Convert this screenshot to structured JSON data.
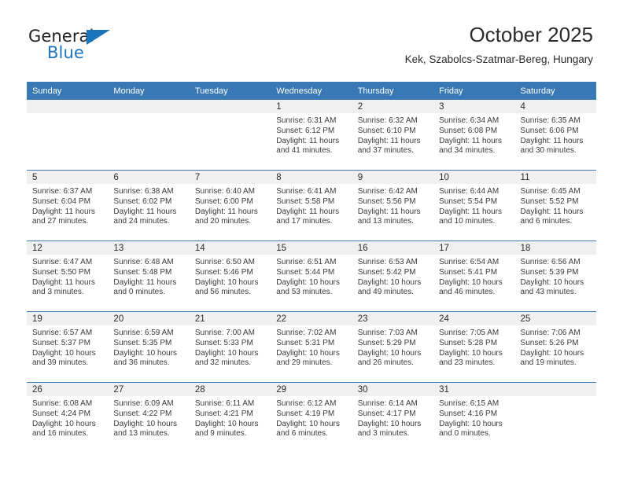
{
  "branding": {
    "logo_text_primary": "General",
    "logo_text_secondary": "Blue",
    "accent_color": "#1b75bb",
    "header_bar_color": "#3878b4"
  },
  "header": {
    "title": "October 2025",
    "subtitle": "Kek, Szabolcs-Szatmar-Bereg, Hungary"
  },
  "weekday_headers": [
    "Sunday",
    "Monday",
    "Tuesday",
    "Wednesday",
    "Thursday",
    "Friday",
    "Saturday"
  ],
  "calendar": {
    "month": "October",
    "year": "2025",
    "labels": {
      "sunrise": "Sunrise:",
      "sunset": "Sunset:",
      "daylight": "Daylight:"
    },
    "weeks": [
      [
        {
          "day": "",
          "empty": true
        },
        {
          "day": "",
          "empty": true
        },
        {
          "day": "",
          "empty": true
        },
        {
          "day": "1",
          "sunrise": "Sunrise: 6:31 AM",
          "sunset": "Sunset: 6:12 PM",
          "daylight_line1": "Daylight: 11 hours",
          "daylight_line2": "and 41 minutes."
        },
        {
          "day": "2",
          "sunrise": "Sunrise: 6:32 AM",
          "sunset": "Sunset: 6:10 PM",
          "daylight_line1": "Daylight: 11 hours",
          "daylight_line2": "and 37 minutes."
        },
        {
          "day": "3",
          "sunrise": "Sunrise: 6:34 AM",
          "sunset": "Sunset: 6:08 PM",
          "daylight_line1": "Daylight: 11 hours",
          "daylight_line2": "and 34 minutes."
        },
        {
          "day": "4",
          "sunrise": "Sunrise: 6:35 AM",
          "sunset": "Sunset: 6:06 PM",
          "daylight_line1": "Daylight: 11 hours",
          "daylight_line2": "and 30 minutes."
        }
      ],
      [
        {
          "day": "5",
          "sunrise": "Sunrise: 6:37 AM",
          "sunset": "Sunset: 6:04 PM",
          "daylight_line1": "Daylight: 11 hours",
          "daylight_line2": "and 27 minutes."
        },
        {
          "day": "6",
          "sunrise": "Sunrise: 6:38 AM",
          "sunset": "Sunset: 6:02 PM",
          "daylight_line1": "Daylight: 11 hours",
          "daylight_line2": "and 24 minutes."
        },
        {
          "day": "7",
          "sunrise": "Sunrise: 6:40 AM",
          "sunset": "Sunset: 6:00 PM",
          "daylight_line1": "Daylight: 11 hours",
          "daylight_line2": "and 20 minutes."
        },
        {
          "day": "8",
          "sunrise": "Sunrise: 6:41 AM",
          "sunset": "Sunset: 5:58 PM",
          "daylight_line1": "Daylight: 11 hours",
          "daylight_line2": "and 17 minutes."
        },
        {
          "day": "9",
          "sunrise": "Sunrise: 6:42 AM",
          "sunset": "Sunset: 5:56 PM",
          "daylight_line1": "Daylight: 11 hours",
          "daylight_line2": "and 13 minutes."
        },
        {
          "day": "10",
          "sunrise": "Sunrise: 6:44 AM",
          "sunset": "Sunset: 5:54 PM",
          "daylight_line1": "Daylight: 11 hours",
          "daylight_line2": "and 10 minutes."
        },
        {
          "day": "11",
          "sunrise": "Sunrise: 6:45 AM",
          "sunset": "Sunset: 5:52 PM",
          "daylight_line1": "Daylight: 11 hours",
          "daylight_line2": "and 6 minutes."
        }
      ],
      [
        {
          "day": "12",
          "sunrise": "Sunrise: 6:47 AM",
          "sunset": "Sunset: 5:50 PM",
          "daylight_line1": "Daylight: 11 hours",
          "daylight_line2": "and 3 minutes."
        },
        {
          "day": "13",
          "sunrise": "Sunrise: 6:48 AM",
          "sunset": "Sunset: 5:48 PM",
          "daylight_line1": "Daylight: 11 hours",
          "daylight_line2": "and 0 minutes."
        },
        {
          "day": "14",
          "sunrise": "Sunrise: 6:50 AM",
          "sunset": "Sunset: 5:46 PM",
          "daylight_line1": "Daylight: 10 hours",
          "daylight_line2": "and 56 minutes."
        },
        {
          "day": "15",
          "sunrise": "Sunrise: 6:51 AM",
          "sunset": "Sunset: 5:44 PM",
          "daylight_line1": "Daylight: 10 hours",
          "daylight_line2": "and 53 minutes."
        },
        {
          "day": "16",
          "sunrise": "Sunrise: 6:53 AM",
          "sunset": "Sunset: 5:42 PM",
          "daylight_line1": "Daylight: 10 hours",
          "daylight_line2": "and 49 minutes."
        },
        {
          "day": "17",
          "sunrise": "Sunrise: 6:54 AM",
          "sunset": "Sunset: 5:41 PM",
          "daylight_line1": "Daylight: 10 hours",
          "daylight_line2": "and 46 minutes."
        },
        {
          "day": "18",
          "sunrise": "Sunrise: 6:56 AM",
          "sunset": "Sunset: 5:39 PM",
          "daylight_line1": "Daylight: 10 hours",
          "daylight_line2": "and 43 minutes."
        }
      ],
      [
        {
          "day": "19",
          "sunrise": "Sunrise: 6:57 AM",
          "sunset": "Sunset: 5:37 PM",
          "daylight_line1": "Daylight: 10 hours",
          "daylight_line2": "and 39 minutes."
        },
        {
          "day": "20",
          "sunrise": "Sunrise: 6:59 AM",
          "sunset": "Sunset: 5:35 PM",
          "daylight_line1": "Daylight: 10 hours",
          "daylight_line2": "and 36 minutes."
        },
        {
          "day": "21",
          "sunrise": "Sunrise: 7:00 AM",
          "sunset": "Sunset: 5:33 PM",
          "daylight_line1": "Daylight: 10 hours",
          "daylight_line2": "and 32 minutes."
        },
        {
          "day": "22",
          "sunrise": "Sunrise: 7:02 AM",
          "sunset": "Sunset: 5:31 PM",
          "daylight_line1": "Daylight: 10 hours",
          "daylight_line2": "and 29 minutes."
        },
        {
          "day": "23",
          "sunrise": "Sunrise: 7:03 AM",
          "sunset": "Sunset: 5:29 PM",
          "daylight_line1": "Daylight: 10 hours",
          "daylight_line2": "and 26 minutes."
        },
        {
          "day": "24",
          "sunrise": "Sunrise: 7:05 AM",
          "sunset": "Sunset: 5:28 PM",
          "daylight_line1": "Daylight: 10 hours",
          "daylight_line2": "and 23 minutes."
        },
        {
          "day": "25",
          "sunrise": "Sunrise: 7:06 AM",
          "sunset": "Sunset: 5:26 PM",
          "daylight_line1": "Daylight: 10 hours",
          "daylight_line2": "and 19 minutes."
        }
      ],
      [
        {
          "day": "26",
          "sunrise": "Sunrise: 6:08 AM",
          "sunset": "Sunset: 4:24 PM",
          "daylight_line1": "Daylight: 10 hours",
          "daylight_line2": "and 16 minutes."
        },
        {
          "day": "27",
          "sunrise": "Sunrise: 6:09 AM",
          "sunset": "Sunset: 4:22 PM",
          "daylight_line1": "Daylight: 10 hours",
          "daylight_line2": "and 13 minutes."
        },
        {
          "day": "28",
          "sunrise": "Sunrise: 6:11 AM",
          "sunset": "Sunset: 4:21 PM",
          "daylight_line1": "Daylight: 10 hours",
          "daylight_line2": "and 9 minutes."
        },
        {
          "day": "29",
          "sunrise": "Sunrise: 6:12 AM",
          "sunset": "Sunset: 4:19 PM",
          "daylight_line1": "Daylight: 10 hours",
          "daylight_line2": "and 6 minutes."
        },
        {
          "day": "30",
          "sunrise": "Sunrise: 6:14 AM",
          "sunset": "Sunset: 4:17 PM",
          "daylight_line1": "Daylight: 10 hours",
          "daylight_line2": "and 3 minutes."
        },
        {
          "day": "31",
          "sunrise": "Sunrise: 6:15 AM",
          "sunset": "Sunset: 4:16 PM",
          "daylight_line1": "Daylight: 10 hours",
          "daylight_line2": "and 0 minutes."
        },
        {
          "day": "",
          "empty": true
        }
      ]
    ]
  }
}
